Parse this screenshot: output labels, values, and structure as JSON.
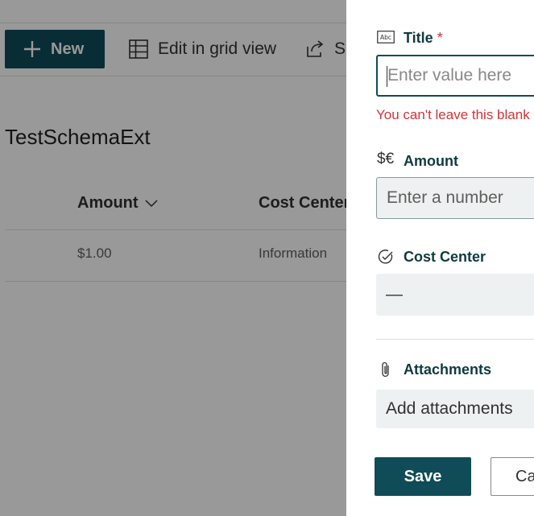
{
  "commandbar": {
    "new_label": "New",
    "grid_label": "Edit in grid view",
    "share_label": "S"
  },
  "list": {
    "title": "TestSchemaExt",
    "columns": [
      "Amount",
      "Cost Center"
    ],
    "rows": [
      {
        "amount": "$1.00",
        "cost_center": "Information"
      }
    ]
  },
  "panel": {
    "title_field": {
      "label": "Title",
      "required_mark": "*",
      "icon_text": "Abc",
      "placeholder": "Enter value here",
      "error": "You can't leave this blank"
    },
    "amount_field": {
      "label": "Amount",
      "icon_text": "$€",
      "placeholder": "Enter a number"
    },
    "cost_center_field": {
      "label": "Cost Center",
      "value": "—"
    },
    "attachments_field": {
      "label": "Attachments",
      "action": "Add attachments"
    },
    "save_label": "Save",
    "cancel_label": "Cancel"
  },
  "colors": {
    "accent": "#0f4c57",
    "error": "#d13438",
    "required": "#c4314b",
    "field_bg": "#edf1f1"
  }
}
